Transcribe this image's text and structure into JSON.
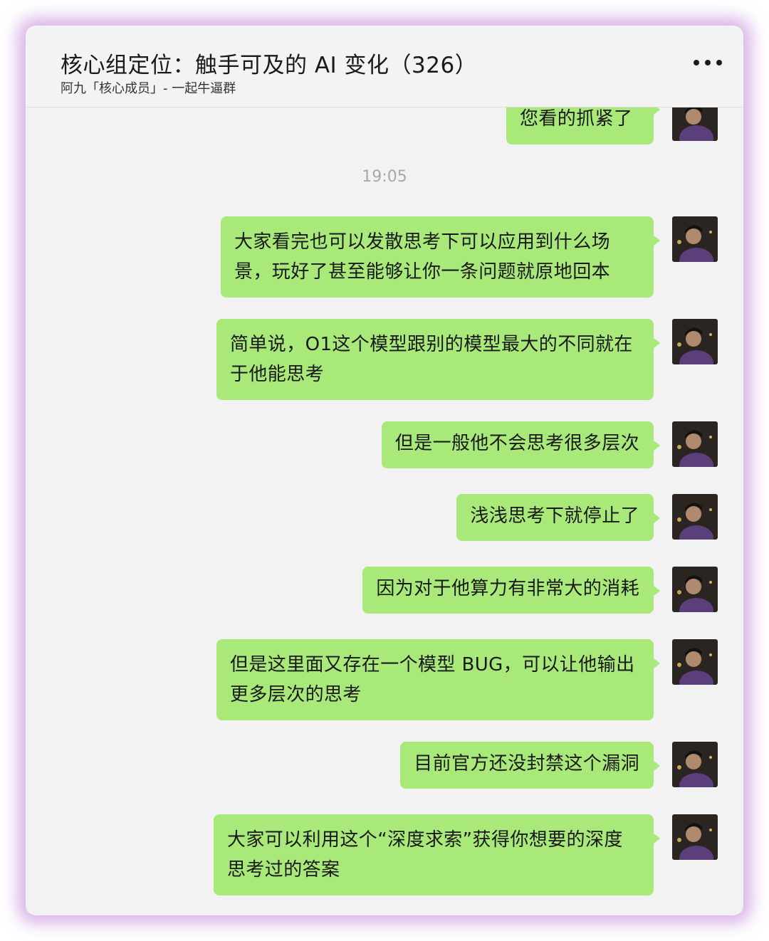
{
  "header": {
    "title": "核心组定位：触手可及的 AI 变化（326）",
    "subtitle": "阿九「核心成员」- 一起牛逼群",
    "more_icon": "more-horizontal-icon"
  },
  "chat": {
    "partial_message": "您看的抓紧了",
    "timestamp": "19:05",
    "messages": [
      {
        "text": "大家看完也可以发散思考下可以应用到什么场景，玩好了甚至能够让你一条问题就原地回本"
      },
      {
        "text": "简单说，O1这个模型跟别的模型最大的不同就在于他能思考"
      },
      {
        "text": "但是一般他不会思考很多层次"
      },
      {
        "text": "浅浅思考下就停止了"
      },
      {
        "text": "因为对于他算力有非常大的消耗"
      },
      {
        "text": "但是这里面又存在一个模型 BUG，可以让他输出更多层次的思考"
      },
      {
        "text": "目前官方还没封禁这个漏洞"
      },
      {
        "text": "大家可以利用这个“深度求索”获得你想要的深度思考过的答案"
      }
    ]
  },
  "colors": {
    "bubble": "#a9e97a",
    "window_bg": "#f2f2f2",
    "glow": "#ba78d6",
    "timestamp": "#a8a8a8"
  }
}
